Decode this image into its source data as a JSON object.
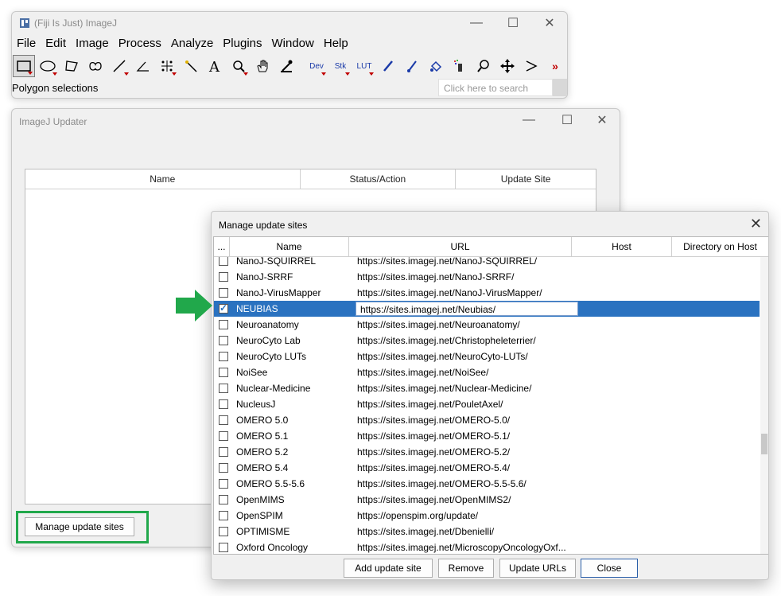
{
  "fiji": {
    "title": "(Fiji Is Just) ImageJ",
    "menu": [
      "File",
      "Edit",
      "Image",
      "Process",
      "Analyze",
      "Plugins",
      "Window",
      "Help"
    ],
    "tools": [
      "rectangle-icon",
      "oval-icon",
      "polygon-icon",
      "freehand-icon",
      "line-icon",
      "angle-icon",
      "multipoint-icon",
      "wand-icon",
      "text-icon",
      "magnifier-icon",
      "hand-icon",
      "dropper-icon",
      "dev-icon",
      "stk-icon",
      "lut-icon",
      "pencil-icon",
      "brush-icon",
      "flood-fill-icon",
      "spray-icon",
      "zoom-icon",
      "move-icon",
      "arrow-tool-icon",
      "more-tools-icon"
    ],
    "tool_text": {
      "dev": "Dev",
      "stk": "Stk",
      "lut": "LUT"
    },
    "status": "Polygon selections",
    "search_placeholder": "Click here to search"
  },
  "updater": {
    "title": "ImageJ Updater",
    "columns": [
      "Name",
      "Status/Action",
      "Update Site"
    ],
    "manage_button": "Manage update sites"
  },
  "manage": {
    "title": "Manage update sites",
    "columns": [
      "...",
      "Name",
      "URL",
      "Host",
      "Directory on Host"
    ],
    "rows": [
      {
        "name": "NanoJ-SQUIRREL",
        "url": "https://sites.imagej.net/NanoJ-SQUIRREL/",
        "checked": false
      },
      {
        "name": "NanoJ-SRRF",
        "url": "https://sites.imagej.net/NanoJ-SRRF/",
        "checked": false
      },
      {
        "name": "NanoJ-VirusMapper",
        "url": "https://sites.imagej.net/NanoJ-VirusMapper/",
        "checked": false
      },
      {
        "name": "NEUBIAS",
        "url": "https://sites.imagej.net/Neubias/",
        "checked": true
      },
      {
        "name": "Neuroanatomy",
        "url": "https://sites.imagej.net/Neuroanatomy/",
        "checked": false
      },
      {
        "name": "NeuroCyto Lab",
        "url": "https://sites.imagej.net/Christopheleterrier/",
        "checked": false
      },
      {
        "name": "NeuroCyto LUTs",
        "url": "https://sites.imagej.net/NeuroCyto-LUTs/",
        "checked": false
      },
      {
        "name": "NoiSee",
        "url": "https://sites.imagej.net/NoiSee/",
        "checked": false
      },
      {
        "name": "Nuclear-Medicine",
        "url": "https://sites.imagej.net/Nuclear-Medicine/",
        "checked": false
      },
      {
        "name": "NucleusJ",
        "url": "https://sites.imagej.net/PouletAxel/",
        "checked": false
      },
      {
        "name": "OMERO 5.0",
        "url": "https://sites.imagej.net/OMERO-5.0/",
        "checked": false
      },
      {
        "name": "OMERO 5.1",
        "url": "https://sites.imagej.net/OMERO-5.1/",
        "checked": false
      },
      {
        "name": "OMERO 5.2",
        "url": "https://sites.imagej.net/OMERO-5.2/",
        "checked": false
      },
      {
        "name": "OMERO 5.4",
        "url": "https://sites.imagej.net/OMERO-5.4/",
        "checked": false
      },
      {
        "name": "OMERO 5.5-5.6",
        "url": "https://sites.imagej.net/OMERO-5.5-5.6/",
        "checked": false
      },
      {
        "name": "OpenMIMS",
        "url": "https://sites.imagej.net/OpenMIMS2/",
        "checked": false
      },
      {
        "name": "OpenSPIM",
        "url": "https://openspim.org/update/",
        "checked": false
      },
      {
        "name": "OPTIMISME",
        "url": "https://sites.imagej.net/Dbenielli/",
        "checked": false
      },
      {
        "name": "Oxford Oncology",
        "url": "https://sites.imagej.net/MicroscopyOncologyOxf...",
        "checked": false
      }
    ],
    "buttons": {
      "add": "Add update site",
      "remove": "Remove",
      "update_urls": "Update URLs",
      "close": "Close"
    }
  },
  "colors": {
    "selection": "#2a72c0",
    "highlight": "#21a84b"
  }
}
